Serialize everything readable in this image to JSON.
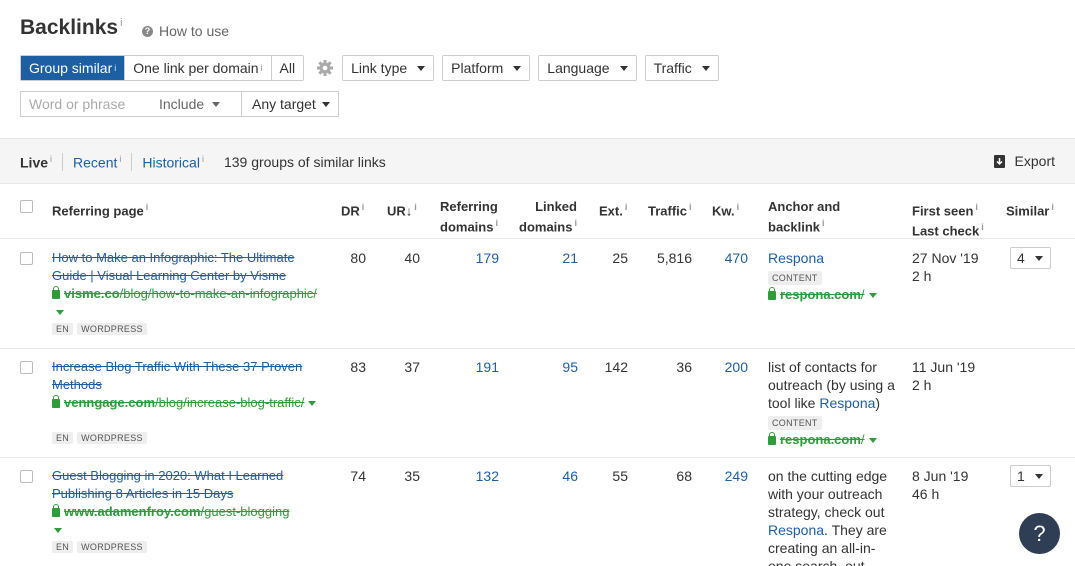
{
  "header": {
    "title": "Backlinks",
    "info": "i",
    "how_to_use": "How to use"
  },
  "filters": {
    "group_options": [
      {
        "label": "Group similar",
        "info": "i",
        "active": true
      },
      {
        "label": "One link per domain",
        "info": "i",
        "active": false
      },
      {
        "label": "All",
        "info": "",
        "active": false
      }
    ],
    "dropdowns": [
      "Link type",
      "Platform",
      "Language",
      "Traffic"
    ],
    "search_placeholder": "Word or phrase",
    "include_label": "Include",
    "target_label": "Any target"
  },
  "tabs": [
    {
      "label": "Live",
      "active": true
    },
    {
      "label": "Recent",
      "active": false
    },
    {
      "label": "Historical",
      "active": false
    }
  ],
  "summary": "139 groups of similar links",
  "export_label": "Export",
  "columns": {
    "referring_page": "Referring page",
    "dr": "DR",
    "ur": "UR",
    "ur_sort": "↓",
    "referring_domains_1": "Referring",
    "referring_domains_2": "domains",
    "linked_domains_1": "Linked",
    "linked_domains_2": "domains",
    "ext": "Ext.",
    "traffic": "Traffic",
    "kw": "Kw.",
    "anchor_1": "Anchor and",
    "anchor_2": "backlink",
    "first_seen": "First seen",
    "last_check": "Last check",
    "similar": "Similar"
  },
  "rows": [
    {
      "title": "How to Make an Infographic: The Ultimate Guide | Visual Learning Center by Visme",
      "domain": "visme.co",
      "path": "/blog/how-to-make-an-infographic/",
      "badges": [
        "EN",
        "WORDPRESS"
      ],
      "dr": "80",
      "ur": "40",
      "ref_domains": "179",
      "linked_domains": "21",
      "ext": "25",
      "traffic": "5,816",
      "kw": "470",
      "anchor_before": "",
      "anchor_link": "Respona",
      "anchor_after": "",
      "anchor_badge": "CONTENT",
      "backlink_domain": "respona.com",
      "backlink_path": "/",
      "first_seen": "27 Nov '19",
      "last_check": "2 h",
      "similar": "4"
    },
    {
      "title": "Increase Blog Traffic With These 37 Proven Methods",
      "domain": "venngage.com",
      "path": "/blog/increase-blog-traffic/",
      "badges": [
        "EN",
        "WORDPRESS"
      ],
      "dr": "83",
      "ur": "37",
      "ref_domains": "191",
      "linked_domains": "95",
      "ext": "142",
      "traffic": "36",
      "kw": "200",
      "anchor_before": "list of contacts for outreach (by using a tool like ",
      "anchor_link": "Respona",
      "anchor_after": ")",
      "anchor_badge": "CONTENT",
      "backlink_domain": "respona.com",
      "backlink_path": "/",
      "first_seen": "11 Jun '19",
      "last_check": "2 h",
      "similar": ""
    },
    {
      "title": "Guest Blogging in 2020: What I Learned Publishing 8 Articles in 15 Days",
      "domain": "www.adamenfroy.com",
      "path": "/guest-blogging",
      "badges": [
        "EN",
        "WORDPRESS"
      ],
      "dr": "74",
      "ur": "35",
      "ref_domains": "132",
      "linked_domains": "46",
      "ext": "55",
      "traffic": "68",
      "kw": "249",
      "anchor_before": "on the cutting edge with your outreach strategy, check out ",
      "anchor_link": "Respona",
      "anchor_after": ". They are creating an all-in-one search, out",
      "anchor_badge": "",
      "backlink_domain": "",
      "backlink_path": "",
      "first_seen": "8 Jun '19",
      "last_check": "46 h",
      "similar": "1"
    }
  ],
  "help_label": "?"
}
